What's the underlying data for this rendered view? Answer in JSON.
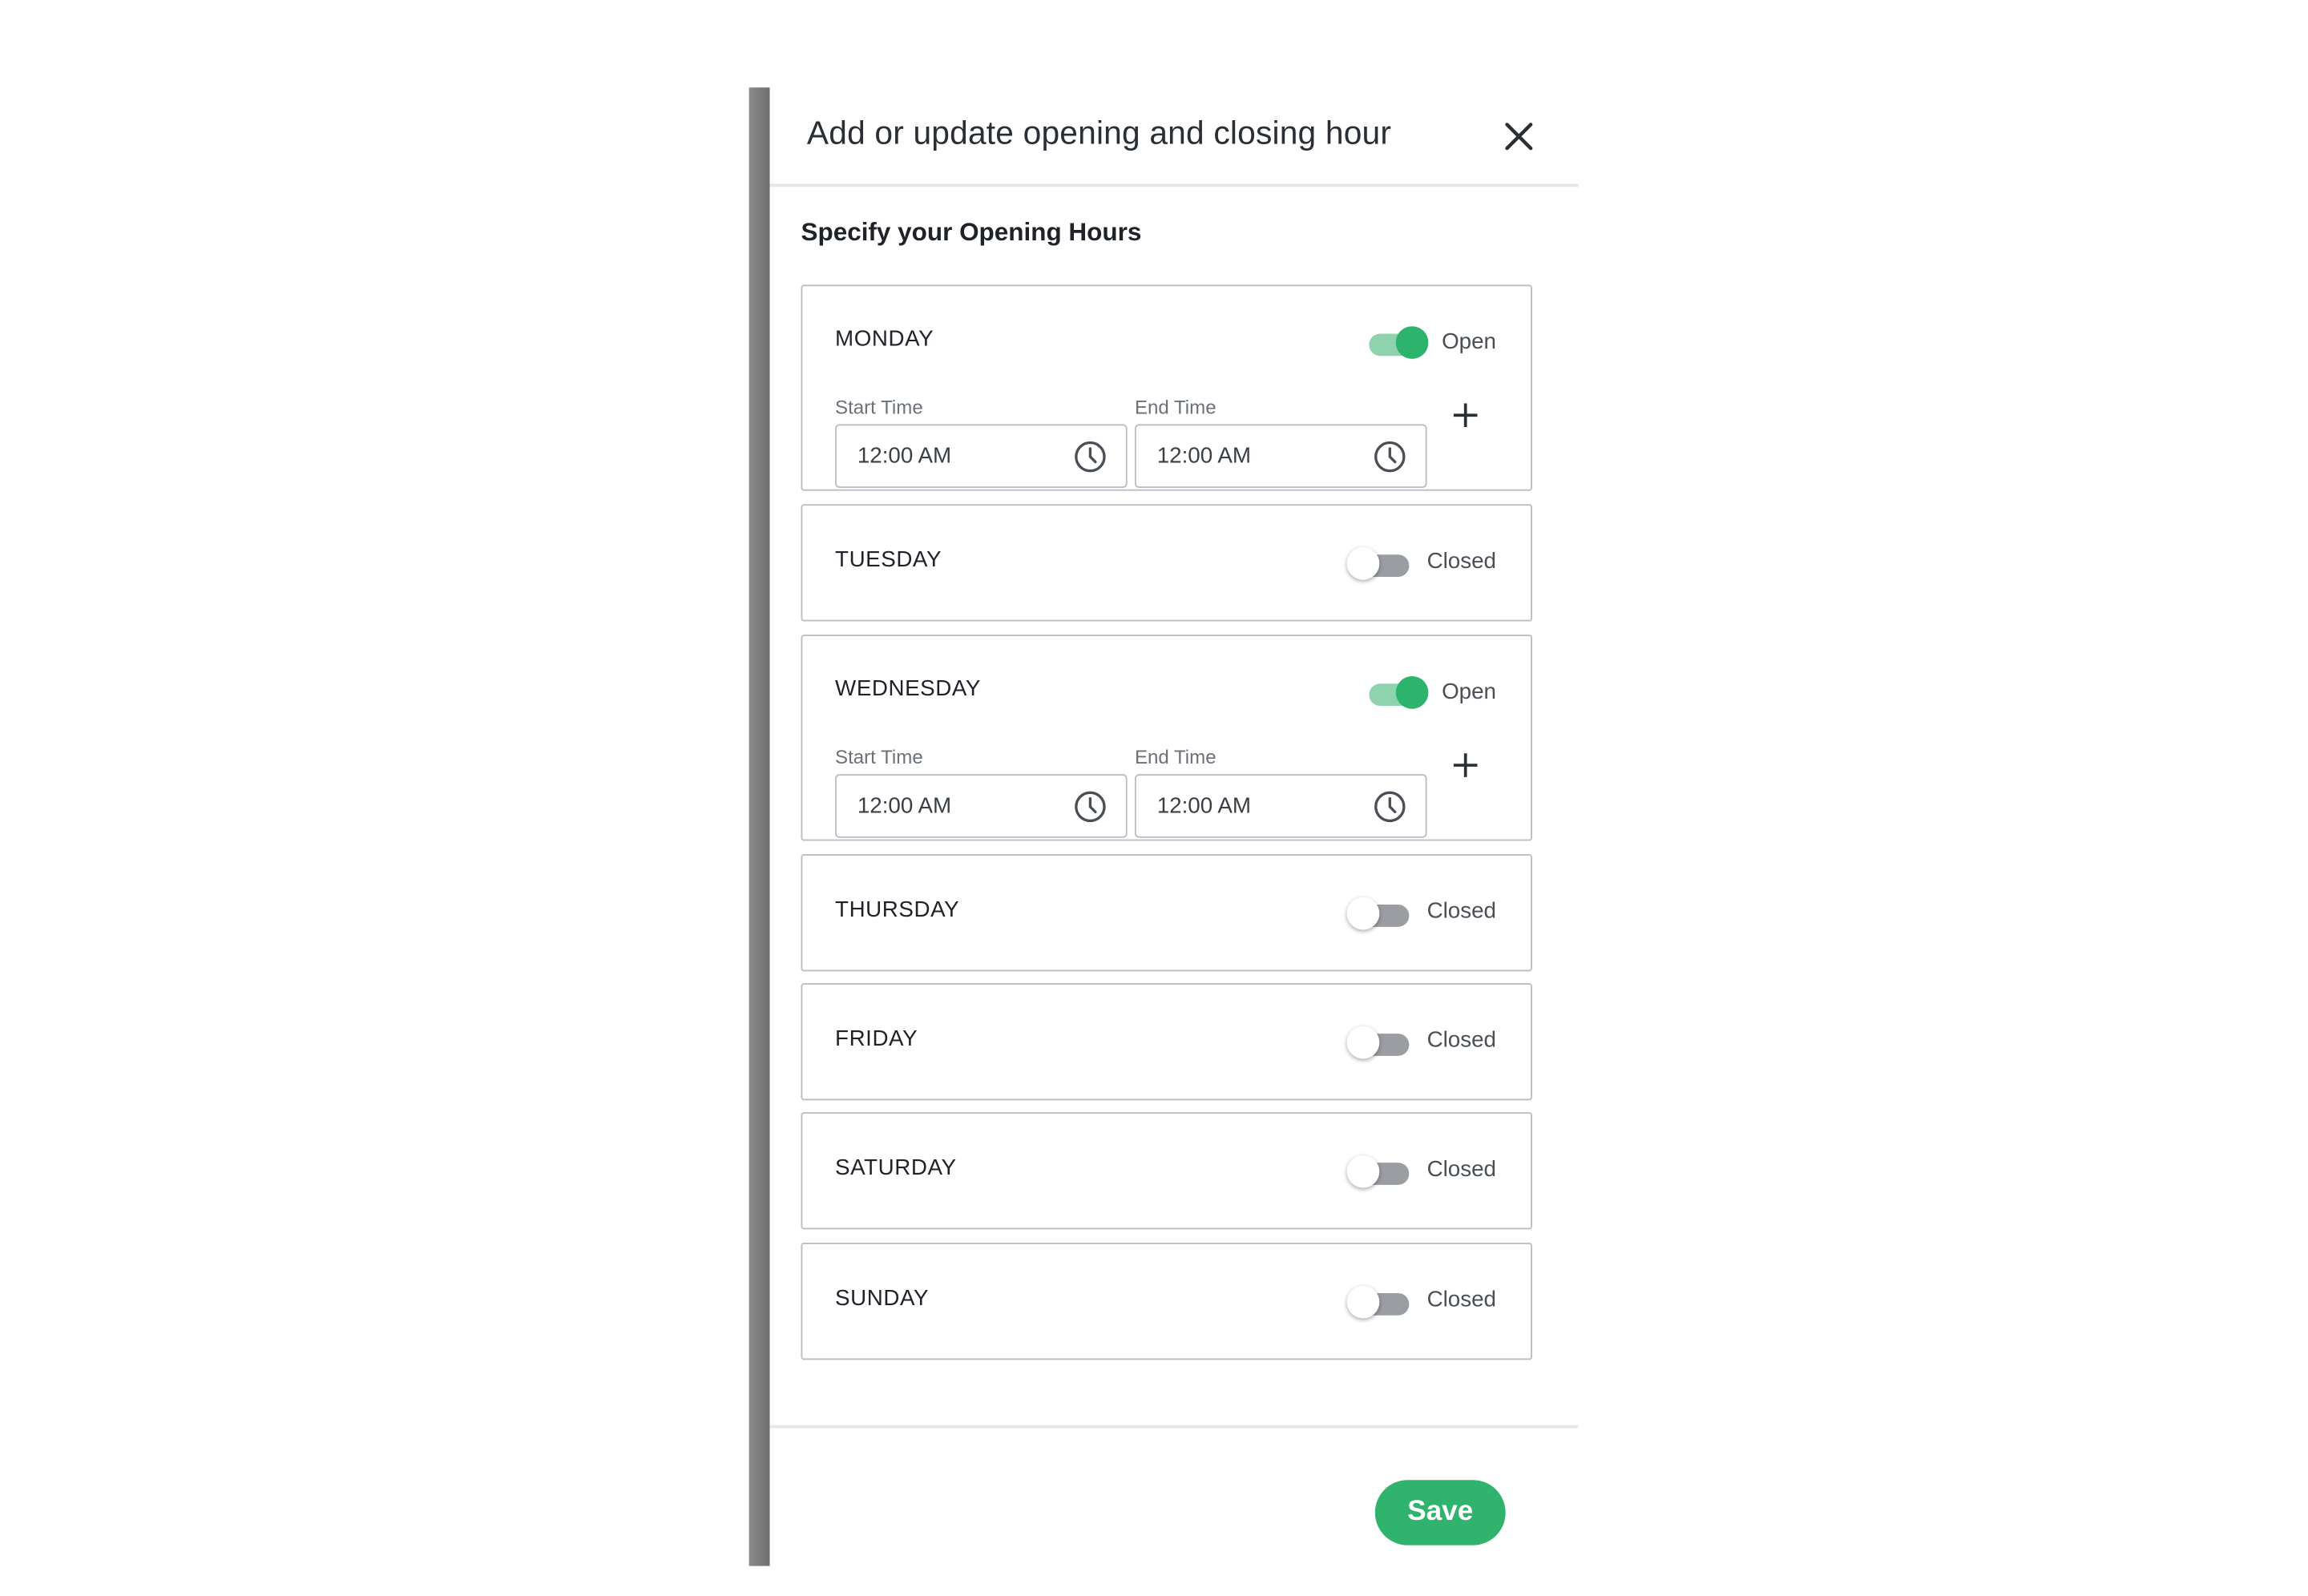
{
  "modal": {
    "title": "Add or update opening and closing hour",
    "close_icon": "close-icon",
    "section_title": "Specify your Opening Hours",
    "save_label": "Save"
  },
  "colors": {
    "accent": "#2fb36d",
    "toggle_on_knob": "#2db36b",
    "toggle_on_track": "#8fd3ae",
    "toggle_off_track": "#9a9ea3",
    "border": "#b9bec4"
  },
  "days": [
    {
      "name": "MONDAY",
      "open": true,
      "status": "Open",
      "start_label": "Start Time",
      "end_label": "End Time",
      "start_time": "12:00 AM",
      "end_time": "12:00 AM"
    },
    {
      "name": "TUESDAY",
      "open": false,
      "status": "Closed"
    },
    {
      "name": "WEDNESDAY",
      "open": true,
      "status": "Open",
      "start_label": "Start Time",
      "end_label": "End Time",
      "start_time": "12:00 AM",
      "end_time": "12:00 AM"
    },
    {
      "name": "THURSDAY",
      "open": false,
      "status": "Closed"
    },
    {
      "name": "FRIDAY",
      "open": false,
      "status": "Closed"
    },
    {
      "name": "SATURDAY",
      "open": false,
      "status": "Closed"
    },
    {
      "name": "SUNDAY",
      "open": false,
      "status": "Closed"
    }
  ]
}
